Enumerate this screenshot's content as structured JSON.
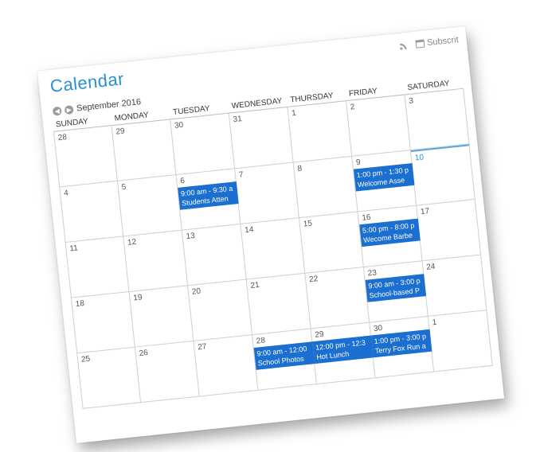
{
  "calendar": {
    "title": "Calendar",
    "subscribe_label": "Subscrit",
    "month_label": "September 2016",
    "prev_symbol": "◀",
    "next_symbol": "▶"
  },
  "weekdays": [
    "SUNDAY",
    "MONDAY",
    "TUESDAY",
    "WEDNESDAY",
    "THURSDAY",
    "FRIDAY",
    "SATURDAY"
  ],
  "days": [
    {
      "num": "28"
    },
    {
      "num": "29"
    },
    {
      "num": "30"
    },
    {
      "num": "31"
    },
    {
      "num": "1"
    },
    {
      "num": "2"
    },
    {
      "num": "3"
    },
    {
      "num": "4"
    },
    {
      "num": "5"
    },
    {
      "num": "6",
      "event_time": "9:00 am - 9:30 a",
      "event_title": "Students Atten"
    },
    {
      "num": "7"
    },
    {
      "num": "8"
    },
    {
      "num": "9",
      "event_time": "1:00 pm - 1:30 p",
      "event_title": "Welcome Asse"
    },
    {
      "num": "10",
      "today": true
    },
    {
      "num": "11"
    },
    {
      "num": "12"
    },
    {
      "num": "13"
    },
    {
      "num": "14"
    },
    {
      "num": "15"
    },
    {
      "num": "16",
      "event_time": "5:00 pm - 8:00 p",
      "event_title": "Wecome Barbe"
    },
    {
      "num": "17"
    },
    {
      "num": "18"
    },
    {
      "num": "19"
    },
    {
      "num": "20"
    },
    {
      "num": "21"
    },
    {
      "num": "22"
    },
    {
      "num": "23",
      "event_time": "9:00 am - 3:00 p",
      "event_title": "School-based P"
    },
    {
      "num": "24"
    },
    {
      "num": "25"
    },
    {
      "num": "26"
    },
    {
      "num": "27"
    },
    {
      "num": "28",
      "event_time": "9:00 am - 12:00",
      "event_title": "School Photos"
    },
    {
      "num": "29",
      "event_time": "12:00 pm - 12:3",
      "event_title": "Hot Lunch"
    },
    {
      "num": "30",
      "event_time": "1:00 pm - 3:00 p",
      "event_title": "Terry Fox Run a"
    },
    {
      "num": "1"
    }
  ],
  "colors": {
    "accent": "#2a8fd6",
    "event_bg": "#1a6fd0"
  }
}
